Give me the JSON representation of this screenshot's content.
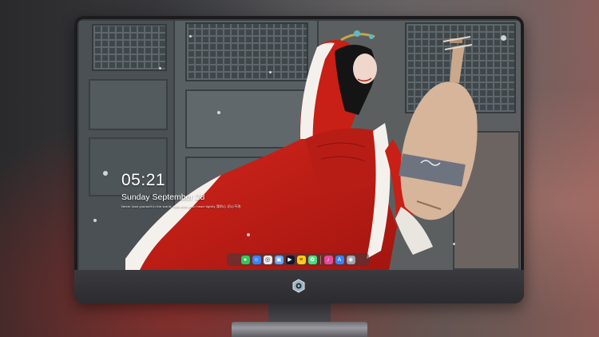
{
  "lock_screen": {
    "time": "05:21",
    "date": "Sunday September  28",
    "tagline": "Never lose yourself in the world, hold onto your heart tightly  我的心 初心不改"
  },
  "dock": {
    "apps": [
      {
        "name": "messages-icon",
        "color": "#34c759",
        "glyph": "●"
      },
      {
        "name": "finder-icon",
        "color": "#3b82f6",
        "glyph": "☺"
      },
      {
        "name": "safari-icon",
        "color": "#e5e7eb",
        "glyph": "◎"
      },
      {
        "name": "preview-icon",
        "color": "#60a5fa",
        "glyph": "▣"
      },
      {
        "name": "clapper-icon",
        "color": "#111827",
        "glyph": "▶"
      },
      {
        "name": "notes-icon",
        "color": "#facc15",
        "glyph": "≡"
      },
      {
        "name": "photos-icon",
        "color": "#4ade80",
        "glyph": "✿"
      },
      {
        "name": "itunes-icon",
        "color": "#ec4899",
        "glyph": "♪"
      },
      {
        "name": "app-store-icon",
        "color": "#3b82f6",
        "glyph": "A"
      },
      {
        "name": "camera-icon",
        "color": "#9ca3af",
        "glyph": "◉"
      }
    ]
  },
  "monitor": {
    "logo_icon": "monitor-logo-icon",
    "accent": "#1c1c1f"
  }
}
